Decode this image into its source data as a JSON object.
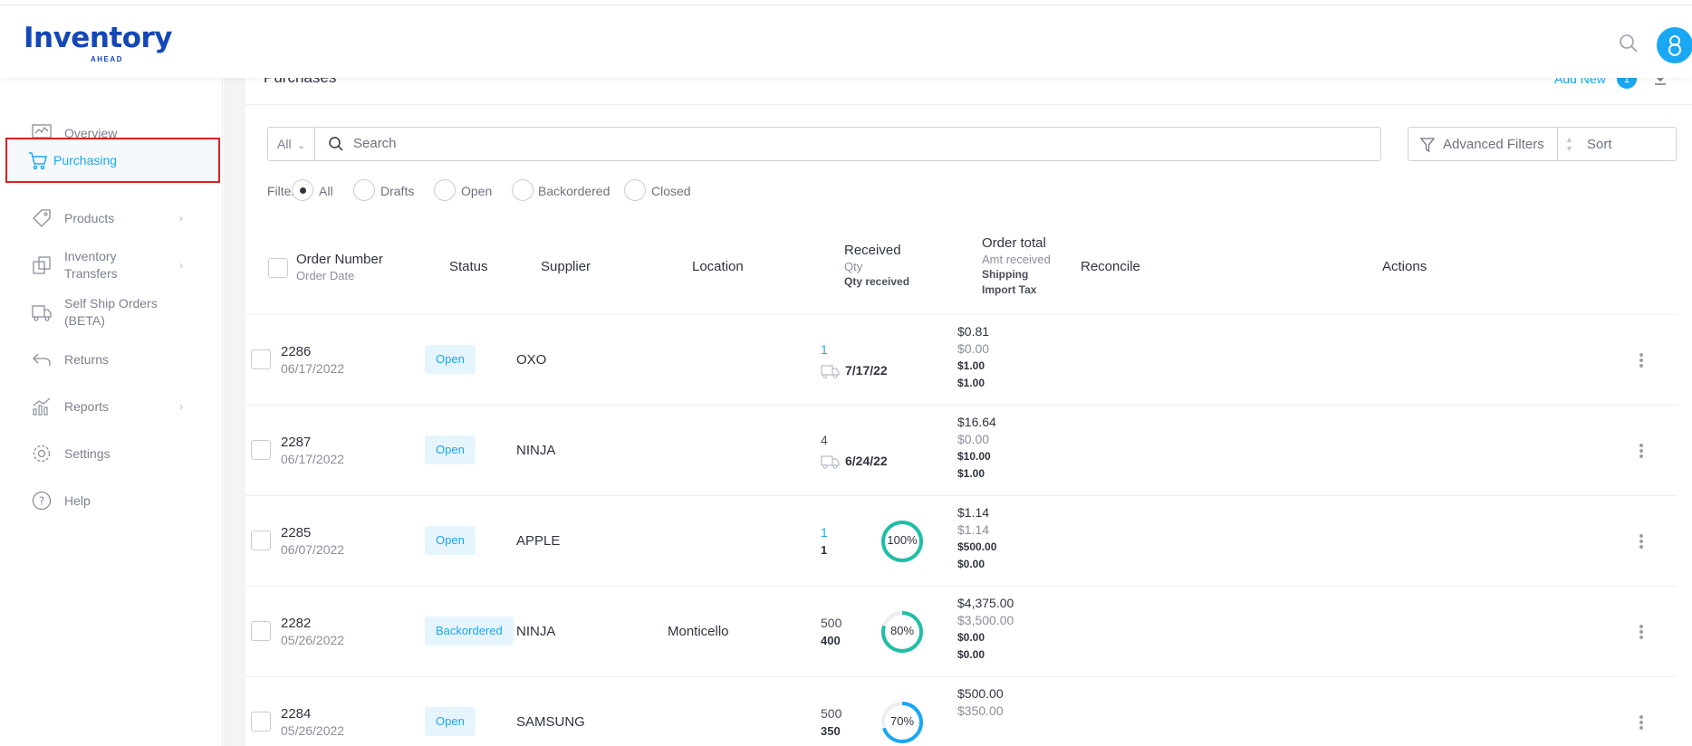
{
  "app": {
    "logo_word": "Inventory",
    "logo_sub": "AHEAD"
  },
  "header": {
    "search_icon": "search-icon",
    "avatar_icon": "user-icon"
  },
  "sidebar": {
    "items": [
      {
        "label": "Overview",
        "icon": "monitor-chart-icon",
        "active": false,
        "chevron": false
      },
      {
        "label": "Purchasing",
        "icon": "cart-icon",
        "active": true,
        "chevron": false
      },
      {
        "label": "Products",
        "icon": "tag-icon",
        "active": false,
        "chevron": true
      },
      {
        "label": "Inventory Transfers",
        "icon": "transfer-icon",
        "active": false,
        "chevron": true
      },
      {
        "label": "Self Ship Orders (BETA)",
        "icon": "truck-icon",
        "active": false,
        "chevron": false
      },
      {
        "label": "Returns",
        "icon": "return-icon",
        "active": false,
        "chevron": false
      },
      {
        "label": "Reports",
        "icon": "bar-chart-icon",
        "active": false,
        "chevron": true
      },
      {
        "label": "Settings",
        "icon": "gear-icon",
        "active": false,
        "chevron": false
      },
      {
        "label": "Help",
        "icon": "help-icon",
        "active": false,
        "chevron": false
      }
    ]
  },
  "page": {
    "title": "Purchases",
    "add_new": "Add New",
    "add_new_count": "1"
  },
  "search": {
    "scope": "All",
    "placeholder": "Search"
  },
  "toolbar": {
    "advanced_filters": "Advanced Filters",
    "sort": "Sort"
  },
  "filters": {
    "prefix": "Filter:",
    "options": [
      {
        "label": "All",
        "checked": true
      },
      {
        "label": "Drafts",
        "checked": false
      },
      {
        "label": "Open",
        "checked": false
      },
      {
        "label": "Backordered",
        "checked": false
      },
      {
        "label": "Closed",
        "checked": false
      }
    ]
  },
  "table": {
    "headers": {
      "order_number": "Order Number",
      "order_date": "Order Date",
      "status": "Status",
      "supplier": "Supplier",
      "location": "Location",
      "received": "Received",
      "qty": "Qty",
      "qty_received": "Qty received",
      "order_total": "Order total",
      "amt_received": "Amt received",
      "shipping": "Shipping",
      "import_tax": "Import Tax",
      "reconcile": "Reconcile",
      "actions": "Actions"
    },
    "rows": [
      {
        "order": "2286",
        "date": "06/17/2022",
        "status": "Open",
        "supplier": "OXO",
        "location": "",
        "qty": "1",
        "qty_link": true,
        "qty_received": "",
        "eta": "7/17/22",
        "progress": null,
        "total": "$0.81",
        "amt_received": "$0.00",
        "shipping": "$1.00",
        "import_tax": "$1.00"
      },
      {
        "order": "2287",
        "date": "06/17/2022",
        "status": "Open",
        "supplier": "NINJA",
        "location": "",
        "qty": "4",
        "qty_link": false,
        "qty_received": "",
        "eta": "6/24/22",
        "progress": null,
        "total": "$16.64",
        "amt_received": "$0.00",
        "shipping": "$10.00",
        "import_tax": "$1.00"
      },
      {
        "order": "2285",
        "date": "06/07/2022",
        "status": "Open",
        "supplier": "APPLE",
        "location": "",
        "qty": "1",
        "qty_link": true,
        "qty_received": "1",
        "eta": "",
        "progress": "100%",
        "progress_value": 100,
        "total": "$1.14",
        "amt_received": "$1.14",
        "shipping": "$500.00",
        "import_tax": "$0.00"
      },
      {
        "order": "2282",
        "date": "05/26/2022",
        "status": "Backordered",
        "supplier": "NINJA",
        "location": "Monticello",
        "qty": "500",
        "qty_link": false,
        "qty_received": "400",
        "eta": "",
        "progress": "80%",
        "progress_value": 80,
        "total": "$4,375.00",
        "amt_received": "$3,500.00",
        "shipping": "$0.00",
        "import_tax": "$0.00"
      },
      {
        "order": "2284",
        "date": "05/26/2022",
        "status": "Open",
        "supplier": "SAMSUNG",
        "location": "",
        "qty": "500",
        "qty_link": false,
        "qty_received": "350",
        "eta": "",
        "progress": "70%",
        "progress_value": 70,
        "total": "$500.00",
        "amt_received": "$350.00",
        "shipping": "",
        "import_tax": ""
      }
    ]
  },
  "colors": {
    "accent": "#1aa7f3",
    "brand": "#1447b8",
    "teal": "#1fbfa5",
    "highlight": "#e02020"
  }
}
